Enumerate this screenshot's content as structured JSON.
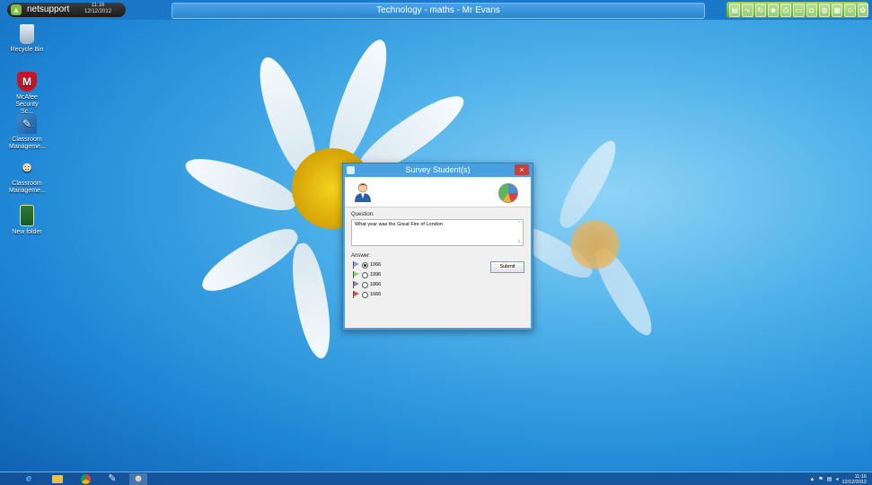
{
  "topbar": {
    "app_name": "netsupport",
    "time": "11:16",
    "date": "12/12/2012",
    "window_title": "Technology - maths - Mr Evans",
    "toolbar_icons": [
      "chart-icon",
      "monitor-icon",
      "refresh-icon",
      "people-icon",
      "print-icon",
      "screen-icon",
      "camera-icon",
      "globe-icon",
      "doc-icon",
      "user-icon",
      "settings-icon"
    ]
  },
  "desktop_icons": [
    {
      "label": "Recycle Bin",
      "icon": "recycle-bin-icon"
    },
    {
      "label": "McAfee Security Sc...",
      "icon": "mcafee-icon"
    },
    {
      "label": "Classroom Manageme...",
      "icon": "classroom-tools-icon"
    },
    {
      "label": "Classroom Manageme...",
      "icon": "classroom-people-icon"
    },
    {
      "label": "New folder",
      "icon": "folder-icon"
    }
  ],
  "dialog": {
    "title": "Survey Student(s)",
    "close": "×",
    "question_label": "Question:",
    "question": "What year was the Great Fire of London",
    "answer_label": "Answer:",
    "answers": [
      {
        "text": "1066",
        "selected": true,
        "flag_color": "#7a9ee6"
      },
      {
        "text": "1996",
        "selected": false,
        "flag_color": "#8fd06a"
      },
      {
        "text": "1866",
        "selected": false,
        "flag_color": "#8a8a8a"
      },
      {
        "text": "1666",
        "selected": false,
        "flag_color": "#e04a3a"
      }
    ],
    "submit_label": "Submit"
  },
  "taskbar": {
    "apps": [
      "ie-icon",
      "explorer-icon",
      "chrome-icon",
      "paint-icon",
      "classroom-icon"
    ],
    "clock_time": "11:16",
    "clock_date": "12/12/2012"
  }
}
